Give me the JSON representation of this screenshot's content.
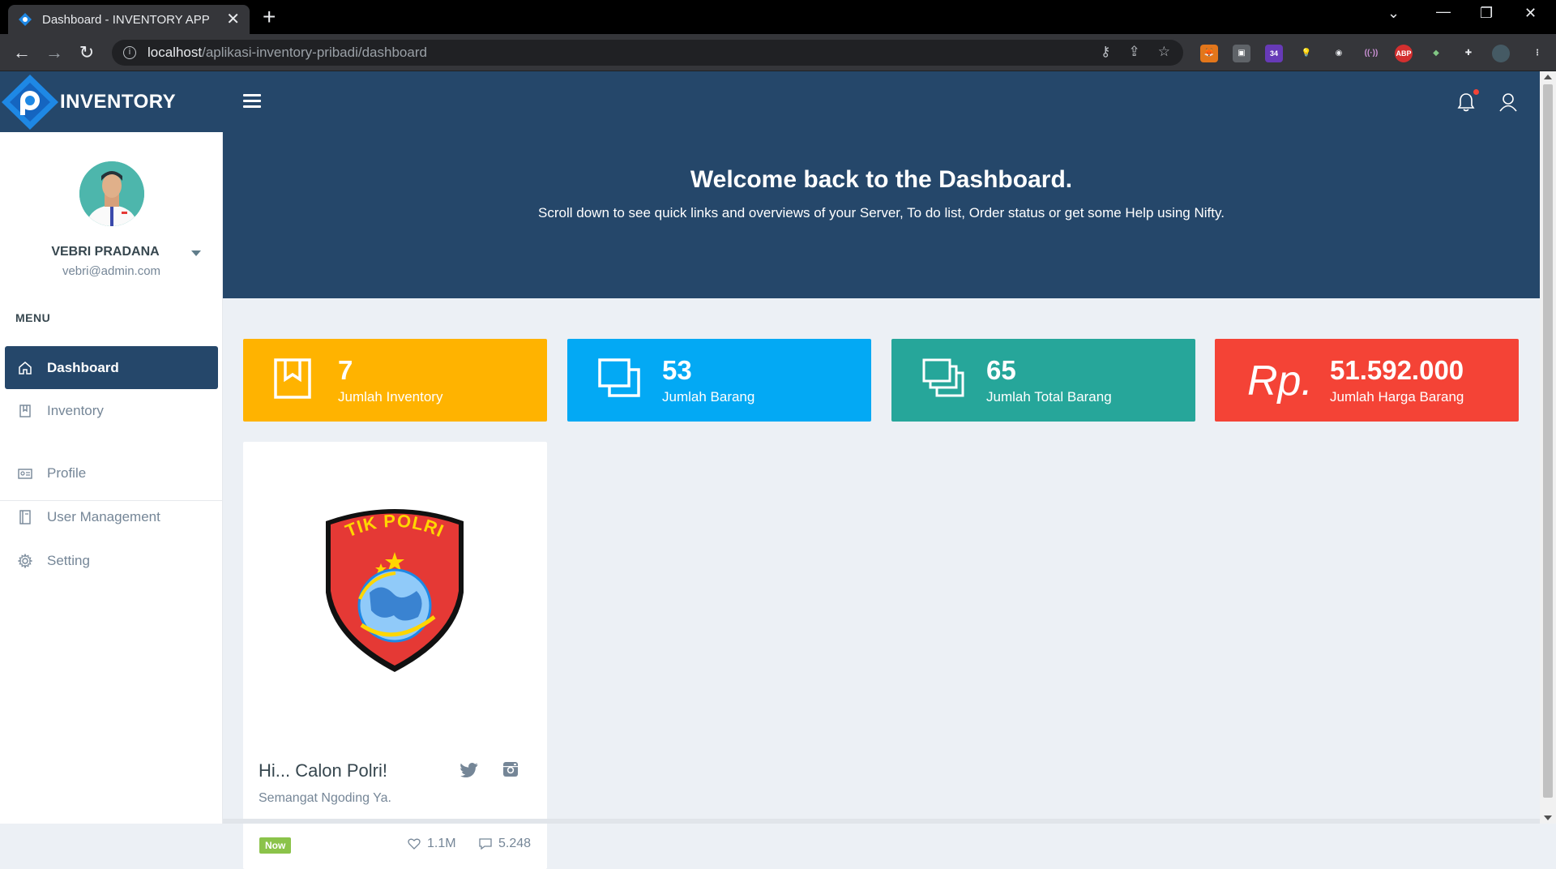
{
  "browser": {
    "tab_title": "Dashboard - INVENTORY APP",
    "url_host": "localhost",
    "url_path": "/aplikasi-inventory-pribadi/dashboard",
    "ext_badge_count": "34",
    "abp_label": "ABP"
  },
  "app": {
    "brand": "INVENTORY",
    "colors": {
      "navy": "#25476a",
      "yellow": "#ffb300",
      "blue": "#03a9f4",
      "teal": "#26a69a",
      "red": "#f44336"
    }
  },
  "hero": {
    "title": "Welcome back to the Dashboard.",
    "subtitle": "Scroll down to see quick links and overviews of your Server, To do list, Order status or get some Help using Nifty."
  },
  "profile": {
    "name": "VEBRI PRADANA",
    "email": "vebri@admin.com"
  },
  "sidebar": {
    "caption": "MENU",
    "items": [
      {
        "label": "Dashboard",
        "icon": "home-icon",
        "active": true
      },
      {
        "label": "Inventory",
        "icon": "book-icon",
        "active": false
      },
      {
        "label": "Profile",
        "icon": "id-card-icon",
        "active": false
      },
      {
        "label": "User Management",
        "icon": "notebook-icon",
        "active": false
      },
      {
        "label": "Setting",
        "icon": "gear-icon",
        "active": false
      }
    ]
  },
  "stats": [
    {
      "value": "7",
      "label": "Jumlah Inventory",
      "icon": "bookmark-icon"
    },
    {
      "value": "53",
      "label": "Jumlah Barang",
      "icon": "windows-icon"
    },
    {
      "value": "65",
      "label": "Jumlah Total Barang",
      "icon": "stacked-windows-icon"
    },
    {
      "value": "51.592.000",
      "label": "Jumlah Harga Barang",
      "prefix": "Rp."
    }
  ],
  "card": {
    "badge_text": "TIK POLRI",
    "title": "Hi... Calon Polri!",
    "description": "Semangat Ngoding Ya.",
    "tag": "Now",
    "likes": "1.1M",
    "comments": "5.248"
  }
}
